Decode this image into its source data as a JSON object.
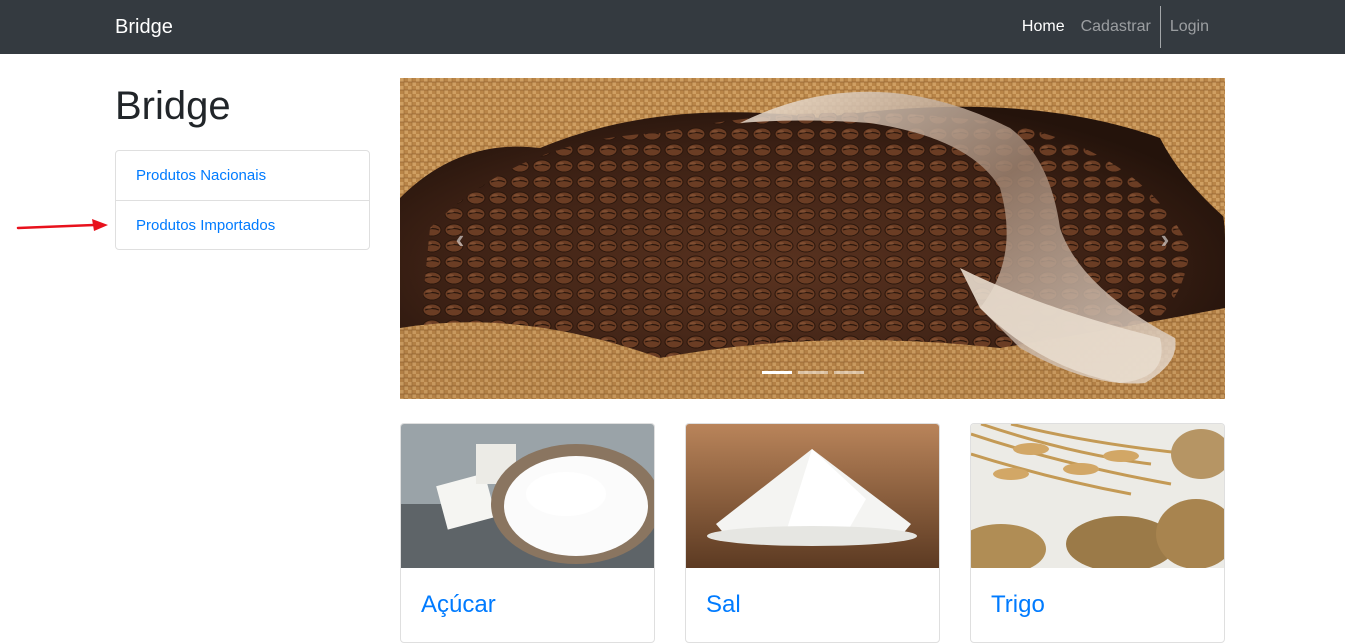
{
  "navbar": {
    "brand": "Bridge",
    "links": [
      {
        "label": "Home",
        "active": true
      },
      {
        "label": "Cadastrar",
        "active": false
      },
      {
        "label": "Login",
        "active": false
      }
    ]
  },
  "sidebar": {
    "title": "Bridge",
    "items": [
      {
        "label": "Produtos Nacionais"
      },
      {
        "label": "Produtos Importados"
      }
    ]
  },
  "carousel": {
    "prev_icon": "chevron-left-icon",
    "next_icon": "chevron-right-icon",
    "prev_glyph": "‹",
    "next_glyph": "›",
    "slide_count": 3,
    "active_slide": 1
  },
  "products": [
    {
      "name": "Açúcar"
    },
    {
      "name": "Sal"
    },
    {
      "name": "Trigo"
    }
  ],
  "colors": {
    "navbar_bg": "#343a40",
    "link": "#007bff",
    "annotation_arrow": "#e8111c"
  }
}
